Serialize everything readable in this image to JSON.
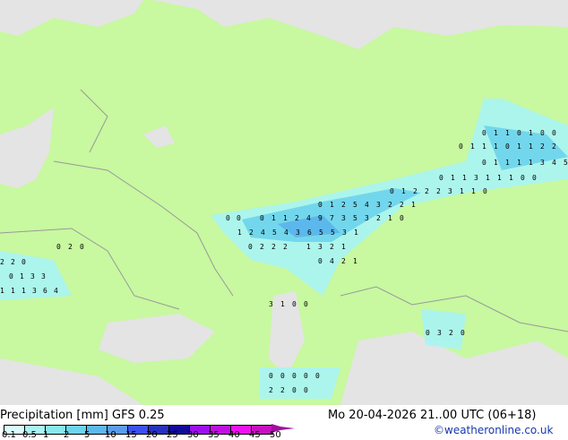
{
  "title": "Precipitation [mm]  GFS 0.25",
  "datetime": "Mo 20-04-2026 21..00 UTC (06+18)",
  "credit": "©weatheronline.co.uk",
  "colors": {
    "land": "#c8f8a0",
    "sea": "#e4e4e4",
    "border": "#999999"
  },
  "legend": {
    "ticks": [
      "0.1",
      "0.5",
      "1",
      "2",
      "5",
      "10",
      "15",
      "20",
      "25",
      "30",
      "35",
      "40",
      "45",
      "50"
    ],
    "colors": [
      "#d8fcfc",
      "#a8f4f4",
      "#88e8ec",
      "#6cd4ec",
      "#5cb8ec",
      "#5c9cec",
      "#3c50f0",
      "#2830c0",
      "#100c98",
      "#9c10f0",
      "#c010e0",
      "#f010f0",
      "#c810c0"
    ]
  },
  "map_labels": [
    {
      "row": "0 1 2 5 4 3 2 2 1"
    },
    {
      "row": "0 0"
    },
    {
      "row": "0 1 1 2 4 9 7 3 5 3 2 1 0"
    },
    {
      "row": "1 2 4 5 4 3 6 5 5 3 1"
    },
    {
      "row": "0 2 2 2"
    },
    {
      "row": "1 3 2 1"
    },
    {
      "row": "0 1 2 2 2 3 1 1 0"
    },
    {
      "row": "0 1 1 3 1 1 1 0 0"
    },
    {
      "row": "0 1 1 1 1 3 4 5"
    },
    {
      "row": "0 1 1 1 0 1 1 2 2"
    },
    {
      "row": "0 1 1 0 1 0 0"
    },
    {
      "row": "0 2 0"
    },
    {
      "row": "2 2 0"
    },
    {
      "row": "0 1 3 3"
    },
    {
      "row": "1 1 1 3 6 4"
    },
    {
      "row": "0 4 2 1"
    },
    {
      "row": "3 1 0 0"
    },
    {
      "row": "0 3 2 0"
    },
    {
      "row": "0 0 0 0 0"
    },
    {
      "row": "2 2 0 0"
    }
  ]
}
